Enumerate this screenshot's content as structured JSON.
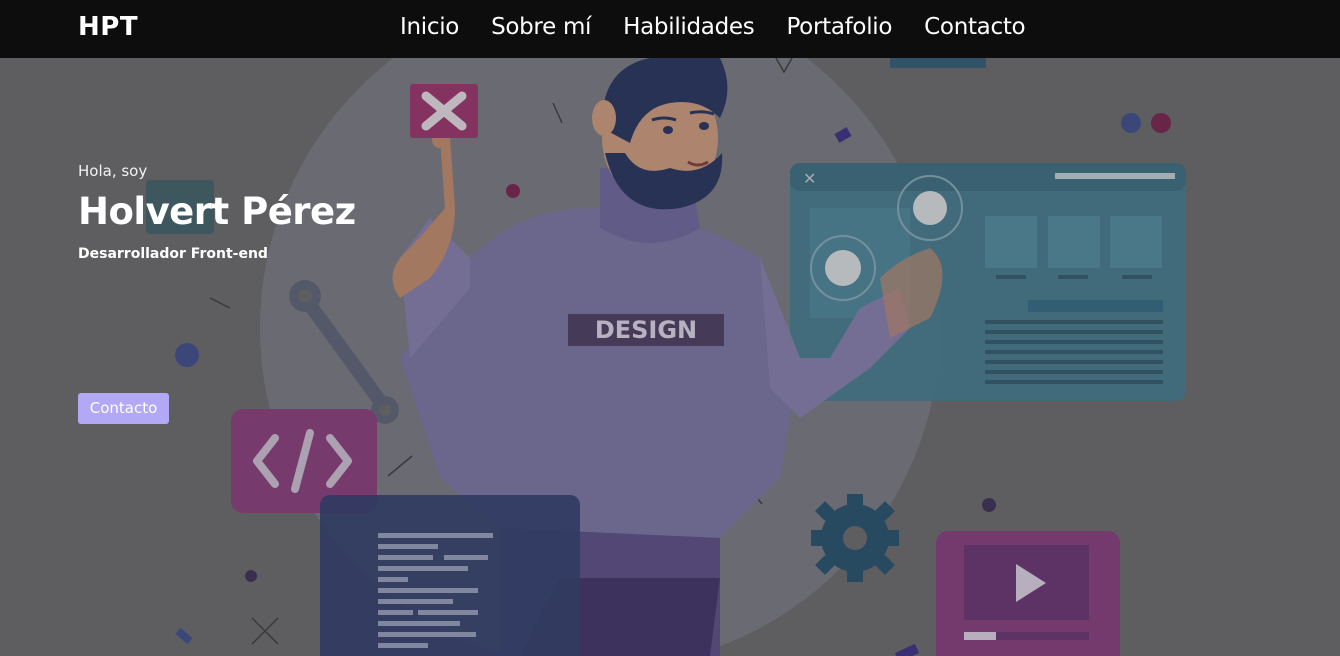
{
  "navbar": {
    "brand": "HPT",
    "links": [
      {
        "label": "Inicio"
      },
      {
        "label": "Sobre mí"
      },
      {
        "label": "Habilidades"
      },
      {
        "label": "Portafolio"
      },
      {
        "label": "Contacto"
      }
    ]
  },
  "hero": {
    "greeting": "Hola, soy",
    "name": "Holvert Pérez",
    "role": "Desarrollador Front-end",
    "cta_label": "Contacto",
    "illustration": {
      "shirt_text": "DESIGN",
      "icons": [
        "close-icon",
        "wrench-icon",
        "code-icon",
        "gear-icon",
        "play-icon",
        "browser-window",
        "code-panel"
      ]
    }
  },
  "colors": {
    "navbar_bg": "#0d0d0d",
    "hero_bg": "#6b6b6e",
    "cta_bg": "#b3a8f5"
  }
}
